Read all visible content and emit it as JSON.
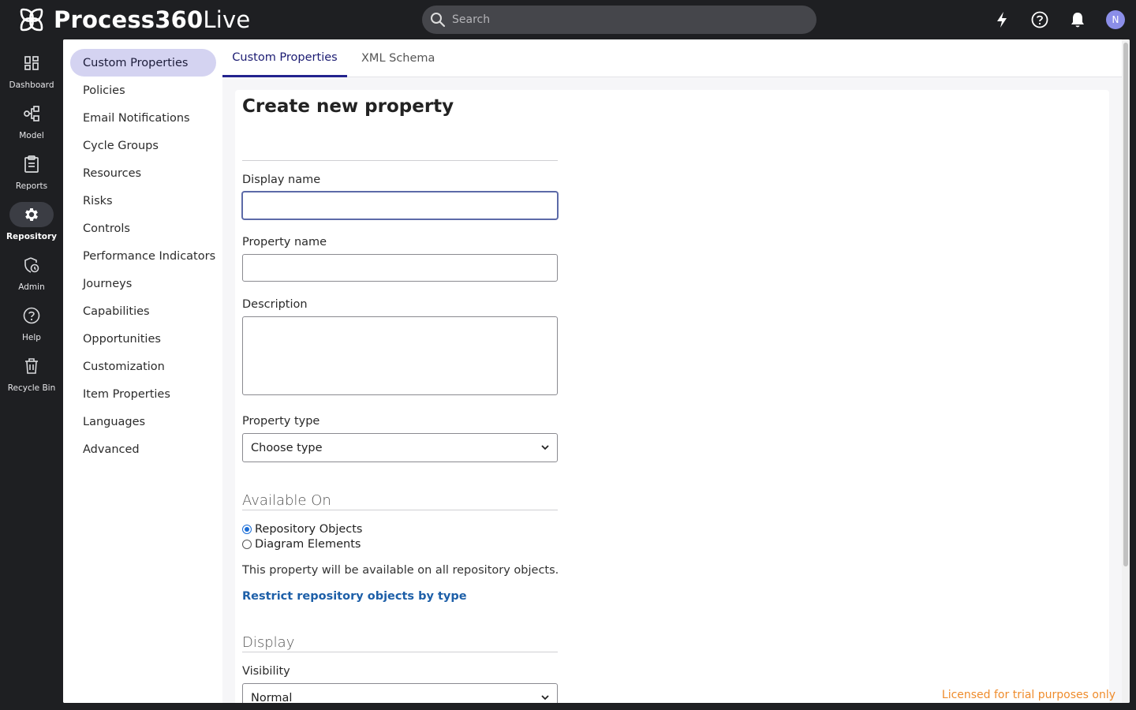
{
  "app": {
    "name_bold": "Process360",
    "name_light": "Live"
  },
  "search": {
    "placeholder": "Search"
  },
  "top_icons": [
    "lightning-icon",
    "help-circle-icon",
    "bell-icon"
  ],
  "user": {
    "initial": "N",
    "avatar_color": "#8b8ee8"
  },
  "left_nav": [
    {
      "label": "Dashboard",
      "icon": "dashboard-icon"
    },
    {
      "label": "Model",
      "icon": "model-icon"
    },
    {
      "label": "Reports",
      "icon": "reports-icon"
    },
    {
      "label": "Repository",
      "icon": "gear-icon",
      "active": true
    },
    {
      "label": "Admin",
      "icon": "admin-icon"
    },
    {
      "label": "Help",
      "icon": "help-icon"
    },
    {
      "label": "Recycle Bin",
      "icon": "trash-icon"
    }
  ],
  "sub_nav": [
    "Custom Properties",
    "Policies",
    "Email Notifications",
    "Cycle Groups",
    "Resources",
    "Risks",
    "Controls",
    "Performance Indicators",
    "Journeys",
    "Capabilities",
    "Opportunities",
    "Customization",
    "Item Properties",
    "Languages",
    "Advanced"
  ],
  "tabs": [
    {
      "label": "Custom Properties",
      "active": true
    },
    {
      "label": "XML Schema"
    }
  ],
  "form": {
    "title": "Create new property",
    "display_name_label": "Display name",
    "display_name_value": "",
    "property_name_label": "Property name",
    "property_name_value": "",
    "description_label": "Description",
    "property_type_label": "Property type",
    "property_type_value": "Choose type",
    "available_on_heading": "Available On",
    "radio_options": [
      {
        "label": "Repository Objects",
        "checked": true
      },
      {
        "label": "Diagram Elements",
        "checked": false
      }
    ],
    "availability_info": "This property will be available on all repository objects.",
    "restrict_link": "Restrict repository objects by type",
    "display_heading": "Display",
    "visibility_label": "Visibility",
    "visibility_value": "Normal"
  },
  "license_note": "Licensed for trial purposes only",
  "colors": {
    "accent": "#23238e",
    "active_sub_bg": "#d4d3f1",
    "link": "#1d5fa8",
    "license": "#ef8c2c"
  }
}
